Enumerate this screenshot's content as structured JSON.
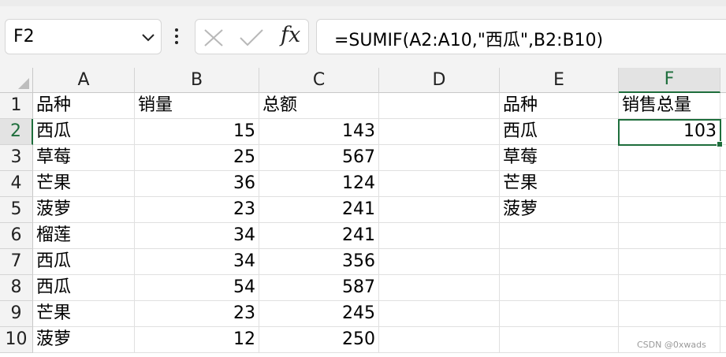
{
  "formula_bar": {
    "name_box": "F2",
    "fx_label": "fx",
    "formula": "=SUMIF(A2:A10,\"西瓜\",B2:B10)"
  },
  "grid": {
    "columns": [
      "A",
      "B",
      "C",
      "D",
      "E",
      "F"
    ],
    "rows": [
      "1",
      "2",
      "3",
      "4",
      "5",
      "6",
      "7",
      "8",
      "9",
      "10"
    ],
    "selected_cell": "F2",
    "cells": {
      "A": [
        "品种",
        "西瓜",
        "草莓",
        "芒果",
        "菠萝",
        "榴莲",
        "西瓜",
        "西瓜",
        "芒果",
        "菠萝"
      ],
      "B": [
        "销量",
        "15",
        "25",
        "36",
        "23",
        "34",
        "34",
        "54",
        "23",
        "12"
      ],
      "C": [
        "总额",
        "143",
        "567",
        "124",
        "241",
        "241",
        "356",
        "587",
        "245",
        "250"
      ],
      "E": [
        "品种",
        "西瓜",
        "草莓",
        "芒果",
        "菠萝"
      ],
      "F": [
        "销售总量",
        "103"
      ]
    }
  },
  "watermark": "CSDN @0xwads",
  "colors": {
    "accent": "#1e6e3c",
    "header_bg": "#f3f3f3",
    "gridline": "#e0e0e0"
  }
}
